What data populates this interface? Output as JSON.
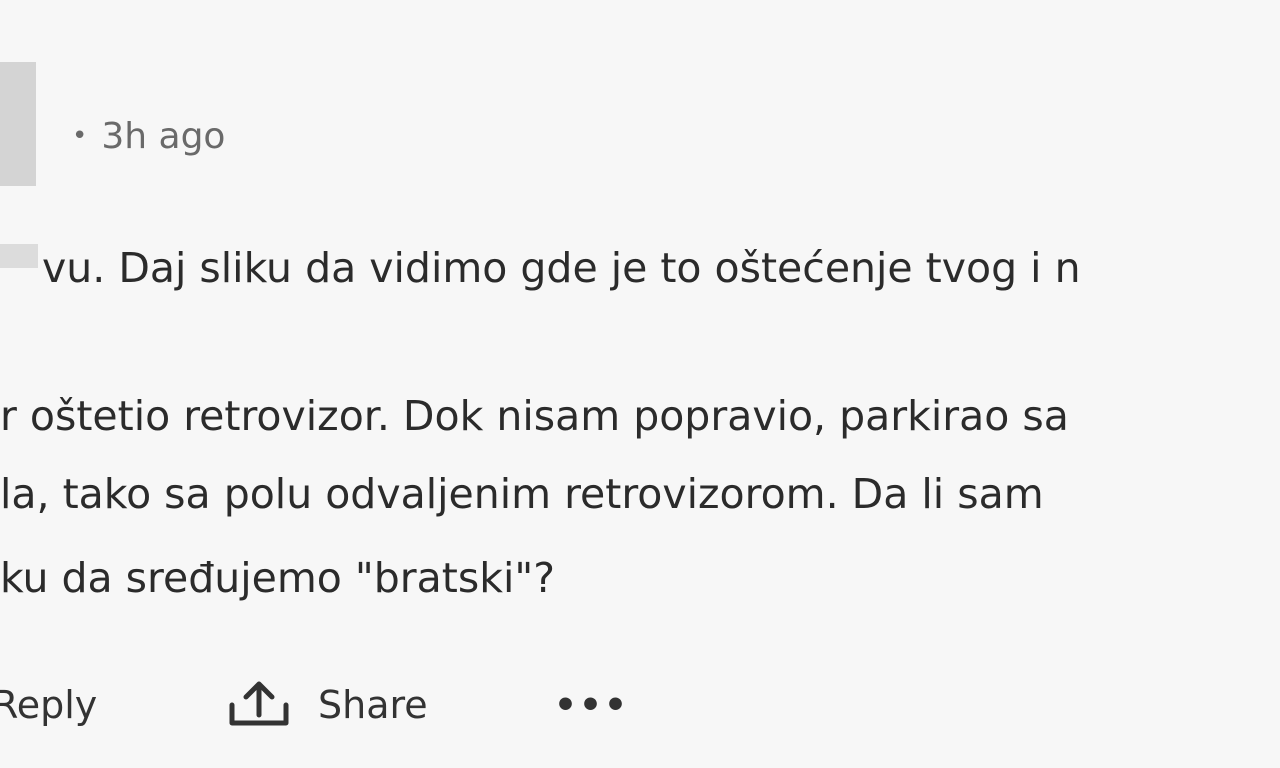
{
  "comment": {
    "meta": {
      "separator": "•",
      "time": "3h ago"
    },
    "lines": [
      "vu. Daj sliku da vidimo gde je to oštećenje tvog i n",
      "r oštetio retrovizor. Dok nisam popravio, parkirao sa",
      "la, tako sa polu odvaljenim retrovizorom. Da li sam",
      "ku da sređujemo \"bratski\"?"
    ]
  },
  "actions": {
    "reply_label": "Reply",
    "share_label": "Share",
    "more_label": "•••",
    "share_icon": "share-arrow-icon",
    "more_icon": "more-dots-icon"
  }
}
